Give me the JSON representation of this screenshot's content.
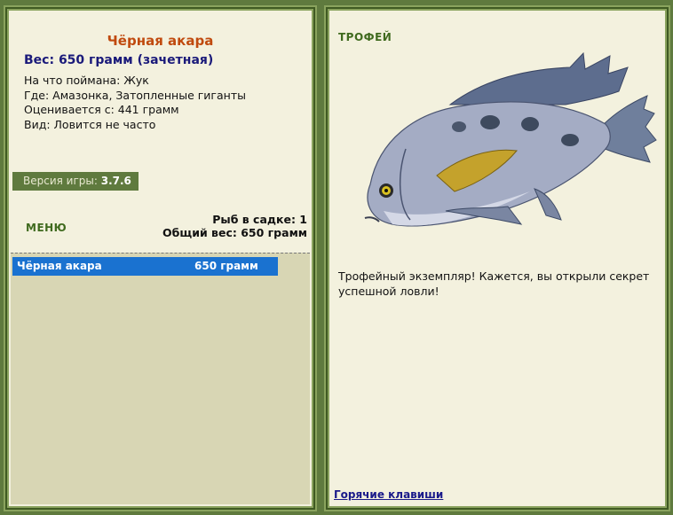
{
  "fish": {
    "name": "Чёрная акара",
    "weight_line": "Вес: 650 грамм (зачетная)",
    "info": [
      "На что поймана: Жук",
      "Где: Амазонка, Затопленные гиганты",
      "Оценивается с: 441 грамм",
      "Вид: Ловится не часто"
    ]
  },
  "version": {
    "label": "Версия игры:",
    "value": "3.7.6"
  },
  "menu_label": "МЕНЮ",
  "cage": {
    "count_line": "Рыб в садке: 1",
    "total_line": "Общий вес: 650 грамм"
  },
  "catch_list": [
    {
      "name": "Чёрная акара",
      "weight": "650 грамм"
    }
  ],
  "trophy": {
    "label": "ТРОФЕЙ",
    "text": "Трофейный экземпляр! Кажется, вы открыли секрет успешной ловли!"
  },
  "hotkeys_label": "Горячие клавиши",
  "colors": {
    "frame": "#5f7a3e",
    "panel": "#f3f1de",
    "title": "#c04a0e",
    "selection": "#1a72d0"
  }
}
